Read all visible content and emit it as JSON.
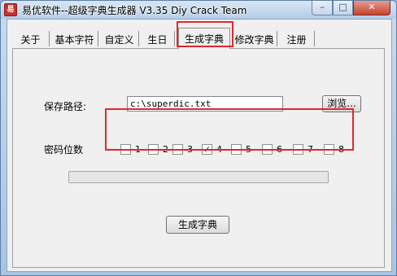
{
  "window": {
    "title": "易优软件--超级字典生成器 V3.35  Diy Crack Team",
    "icon": "app-icon",
    "controls": {
      "minimize": "–",
      "maximize": "□",
      "close": "✕"
    }
  },
  "tabs": [
    {
      "label": "关于"
    },
    {
      "label": "基本字符"
    },
    {
      "label": "自定义"
    },
    {
      "label": "生日"
    },
    {
      "label": "生成字典",
      "active": true
    },
    {
      "label": "修改字典"
    },
    {
      "label": "注册"
    }
  ],
  "form": {
    "path_label": "保存路径:",
    "path_value": "c:\\superdic.txt",
    "browse_label": "浏览...",
    "digits_label": "密码位数",
    "digits": [
      {
        "label": "1",
        "checked": false
      },
      {
        "label": "2",
        "checked": false
      },
      {
        "label": "3",
        "checked": false
      },
      {
        "label": "4",
        "checked": true
      },
      {
        "label": "5",
        "checked": false
      },
      {
        "label": "6",
        "checked": false
      },
      {
        "label": "7",
        "checked": false
      },
      {
        "label": "8",
        "checked": false
      }
    ],
    "progress": 0,
    "generate_label": "生成字典"
  },
  "colors": {
    "highlight": "#e0282e",
    "title_gradient_top": "#d8e6f4"
  }
}
